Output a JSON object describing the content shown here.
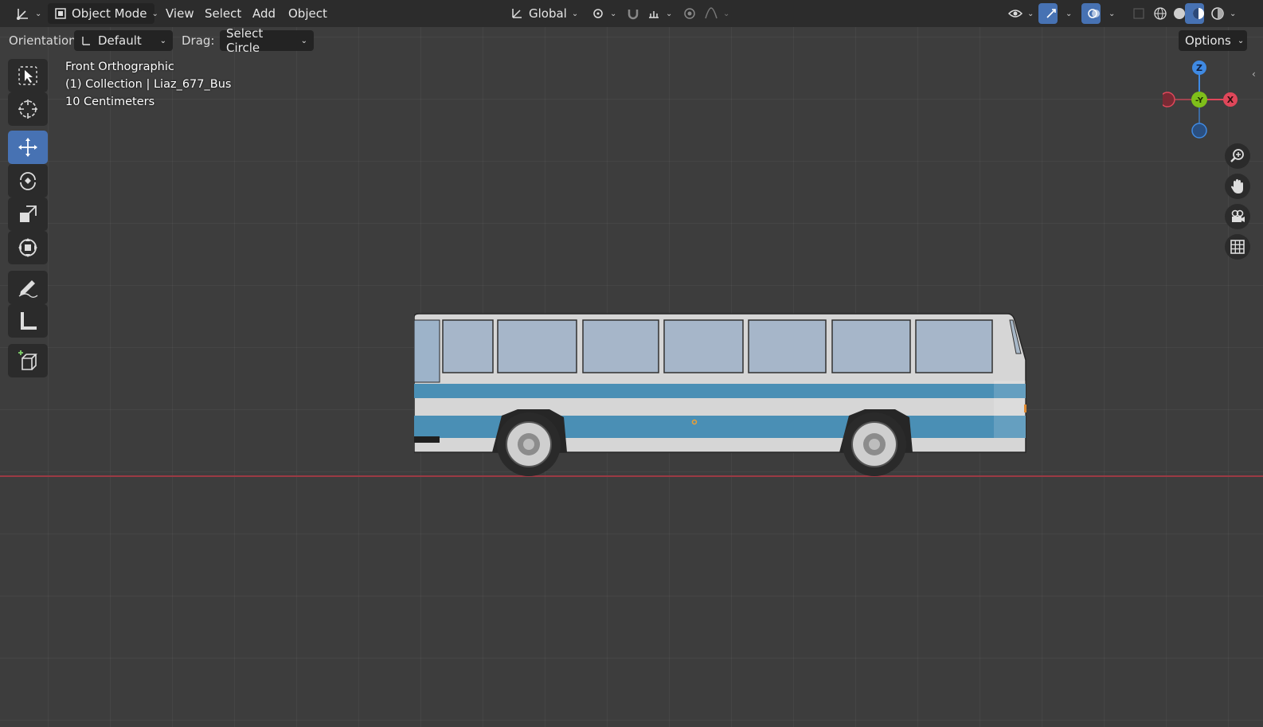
{
  "header": {
    "editor_type_icon": "axis-icon",
    "mode": "Object Mode",
    "menus": [
      "View",
      "Select",
      "Add",
      "Object"
    ],
    "transform_orientation": "Global"
  },
  "tool_header": {
    "orientation_label": "Orientation:",
    "orientation_value": "Default",
    "drag_label": "Drag:",
    "drag_value": "Select Circle",
    "options_label": "Options"
  },
  "viewport": {
    "view_name": "Front Orthographic",
    "collection_line": "(1) Collection | Liaz_677_Bus",
    "scale_line": "10 Centimeters"
  },
  "gizmo": {
    "z": "Z",
    "y": "-Y",
    "x": "X"
  },
  "colors": {
    "active_tool": "#4772b3",
    "x_axis": "#e0475a",
    "y_axis": "#7fbf1a",
    "z_axis": "#3f8ae3",
    "bus_stripe": "#4a8fb5"
  },
  "tools": [
    "select-box",
    "cursor",
    "move",
    "rotate",
    "scale",
    "transform",
    "annotate",
    "measure",
    "add-cube"
  ]
}
